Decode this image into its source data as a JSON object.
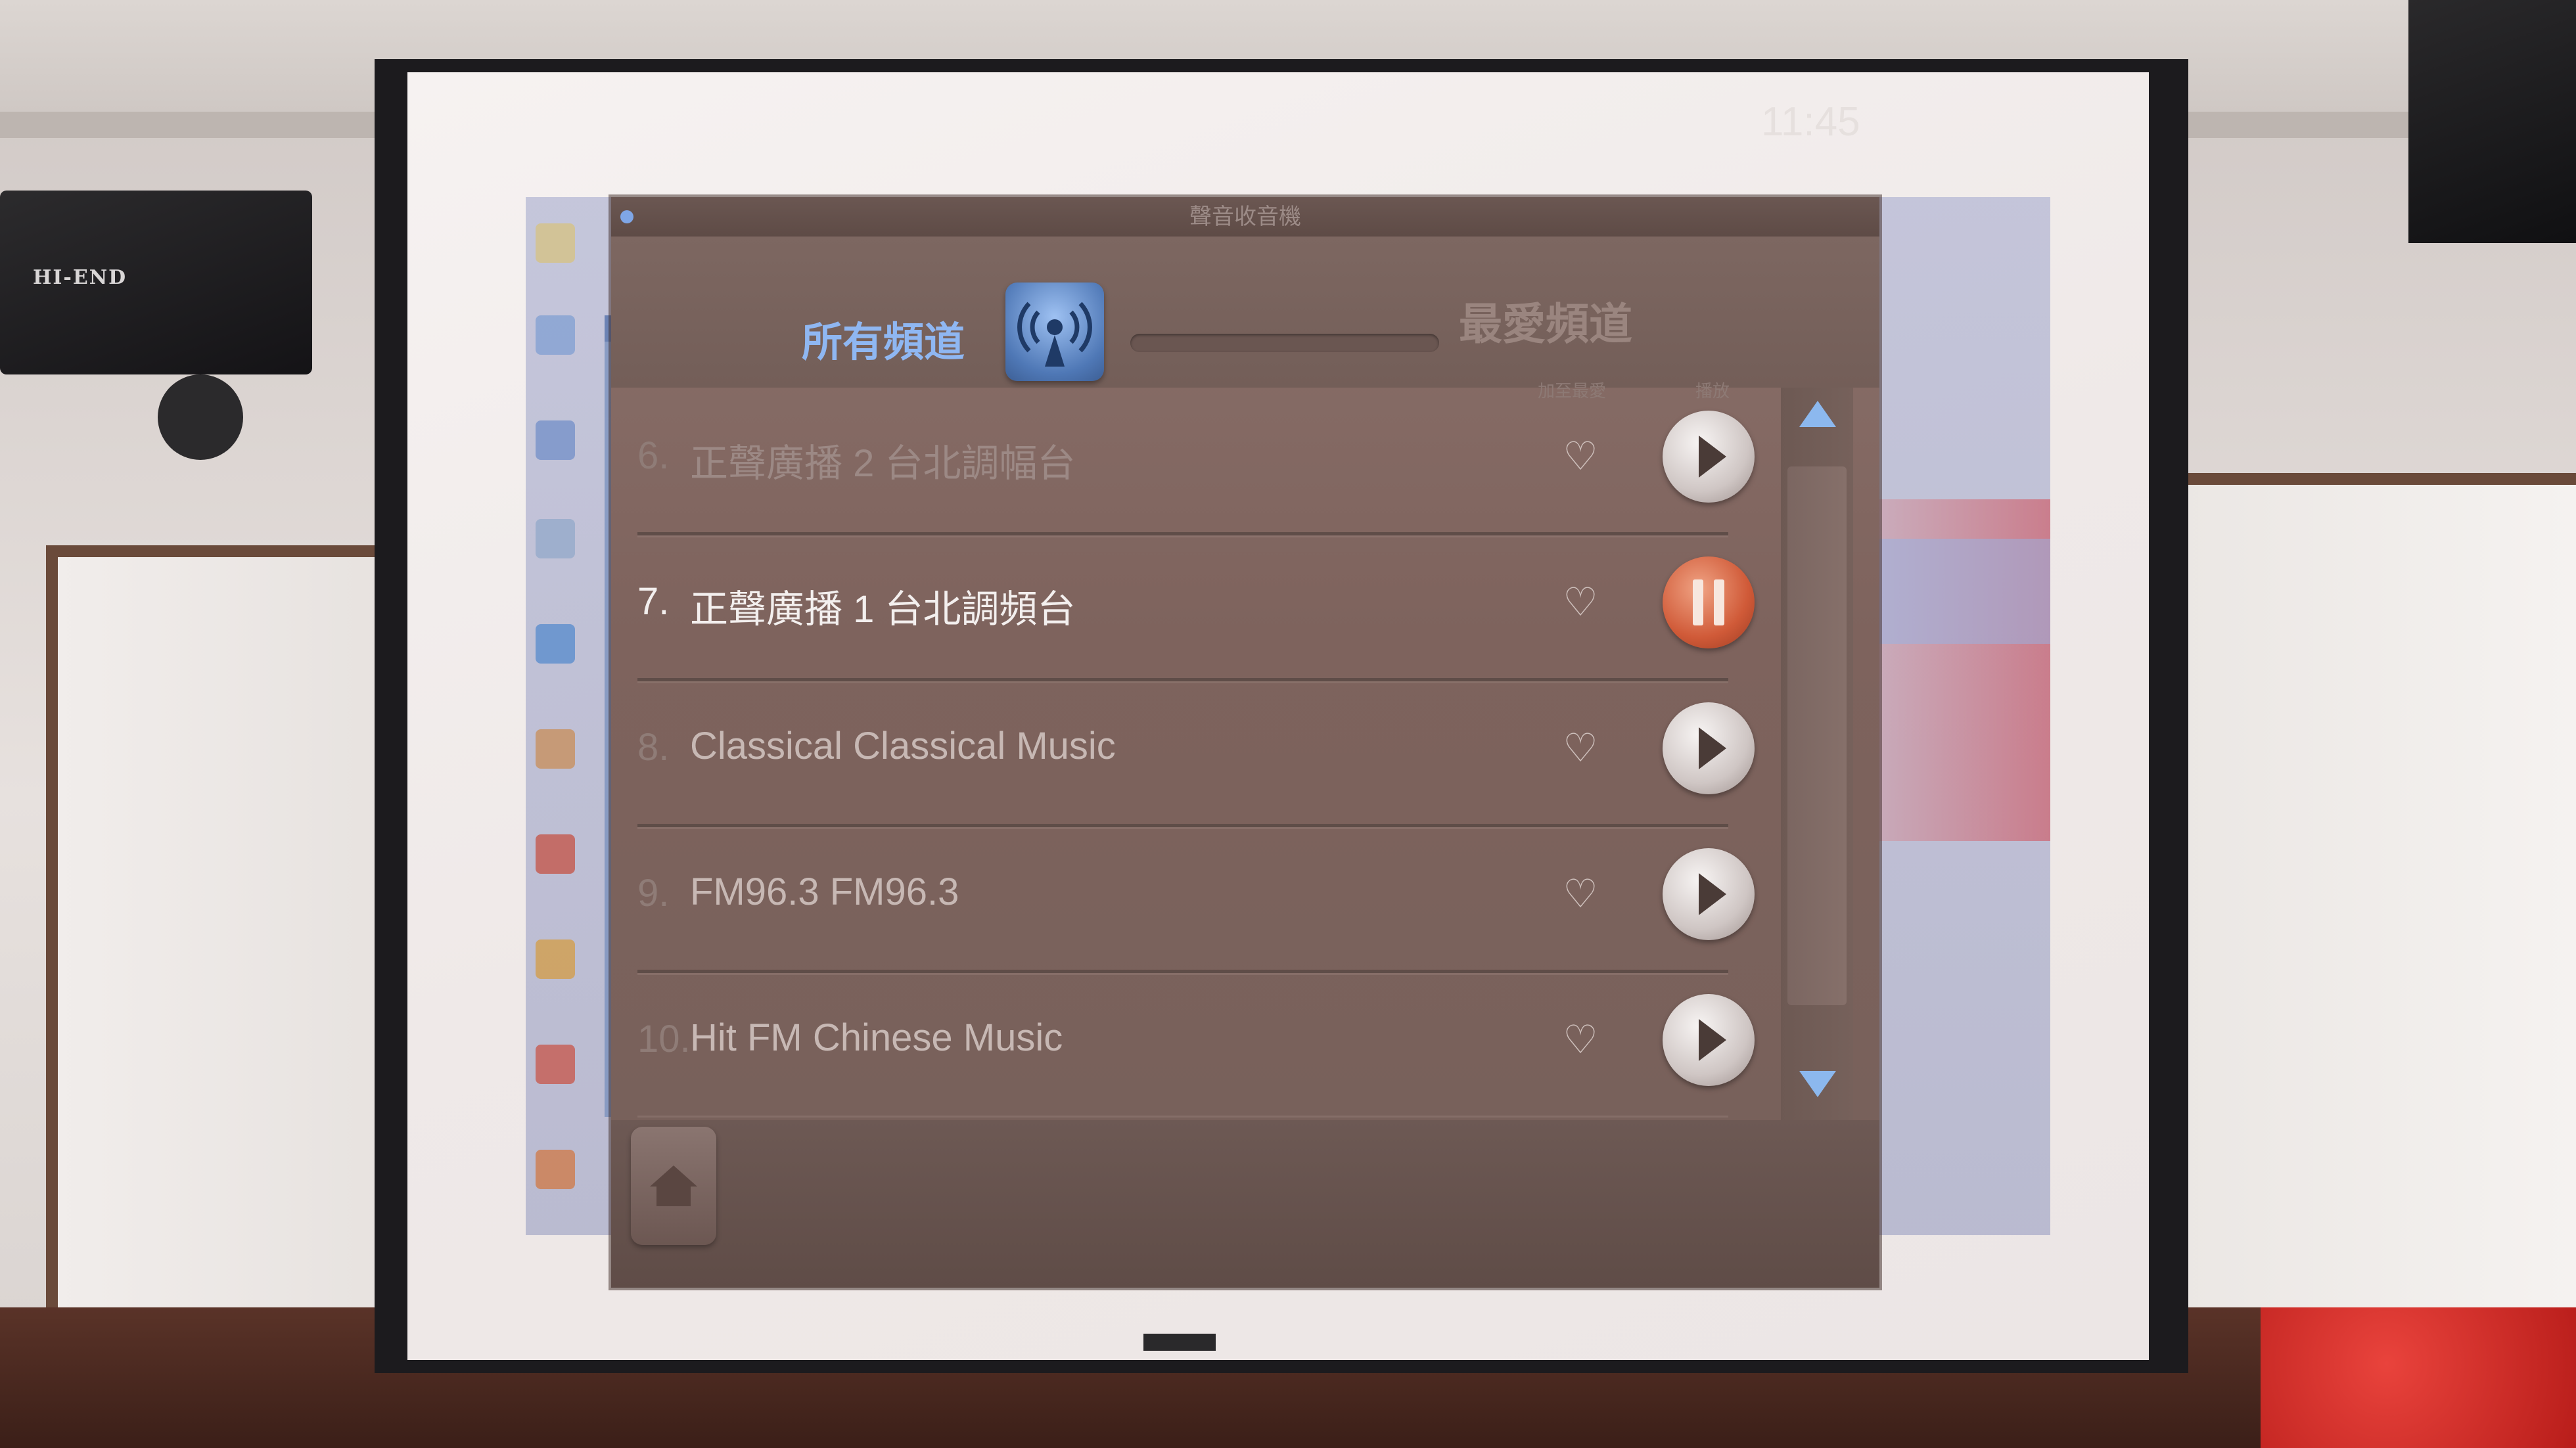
{
  "app": {
    "title": "聲音收音機",
    "clock": "11:45"
  },
  "header": {
    "tab_all": "所有頻道",
    "tab_favorites": "最愛頻道",
    "col_favorite": "加至最愛",
    "col_play": "播放"
  },
  "stations": [
    {
      "index": "6.",
      "name": "正聲廣播 2 台北調幅台",
      "state": "stopped"
    },
    {
      "index": "7.",
      "name": "正聲廣播 1 台北調頻台",
      "state": "playing"
    },
    {
      "index": "8.",
      "name": "Classical Classical Music",
      "state": "stopped"
    },
    {
      "index": "9.",
      "name": "FM96.3 FM96.3",
      "state": "stopped"
    },
    {
      "index": "10.",
      "name": "Hit FM Chinese Music",
      "state": "stopped"
    }
  ],
  "icons": {
    "radio": "broadcast-icon",
    "favorite": "heart-icon",
    "play": "play-icon",
    "pause": "pause-icon",
    "home": "home-icon",
    "scroll_up": "chevron-up-icon",
    "scroll_down": "chevron-down-icon"
  },
  "colors": {
    "accent_blue": "#8fb7f2",
    "pause_red": "#d05a38",
    "app_bg": "#7e635d"
  },
  "room": {
    "speaker_brand": "HI-END"
  }
}
